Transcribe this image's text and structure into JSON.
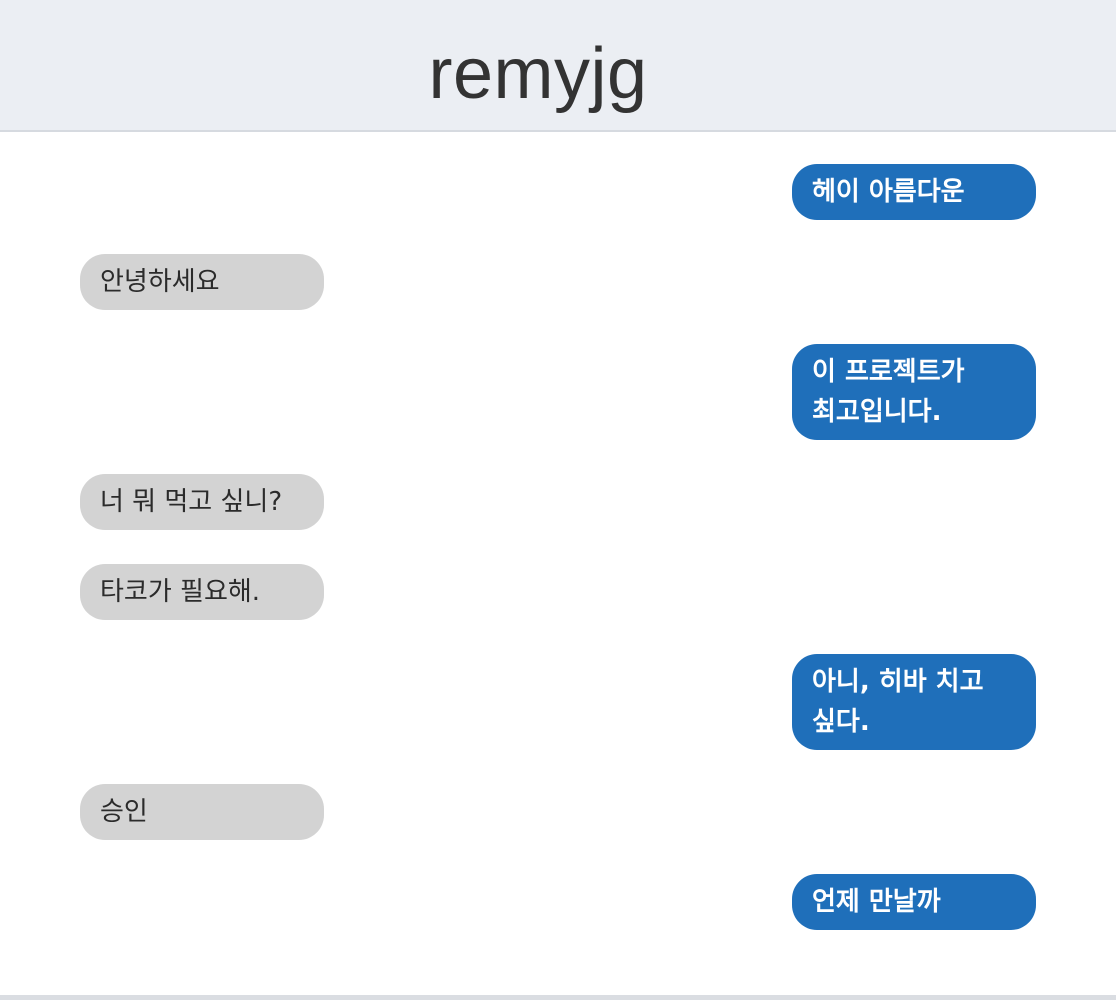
{
  "header": {
    "title": "remyjg"
  },
  "colors": {
    "header_bg": "#ebeef3",
    "sent_bubble": "#1f6fba",
    "received_bubble": "#d3d3d3"
  },
  "messages": [
    {
      "direction": "sent",
      "text": "헤이 아름다운"
    },
    {
      "direction": "received",
      "text": "안녕하세요"
    },
    {
      "direction": "sent",
      "text": "이 프로젝트가 최고입니다."
    },
    {
      "direction": "received",
      "text": "너 뭐 먹고 싶니?"
    },
    {
      "direction": "received",
      "text": "타코가 필요해."
    },
    {
      "direction": "sent",
      "text": "아니, 히바 치고 싶다."
    },
    {
      "direction": "received",
      "text": "승인"
    },
    {
      "direction": "sent",
      "text": "언제 만날까"
    }
  ]
}
